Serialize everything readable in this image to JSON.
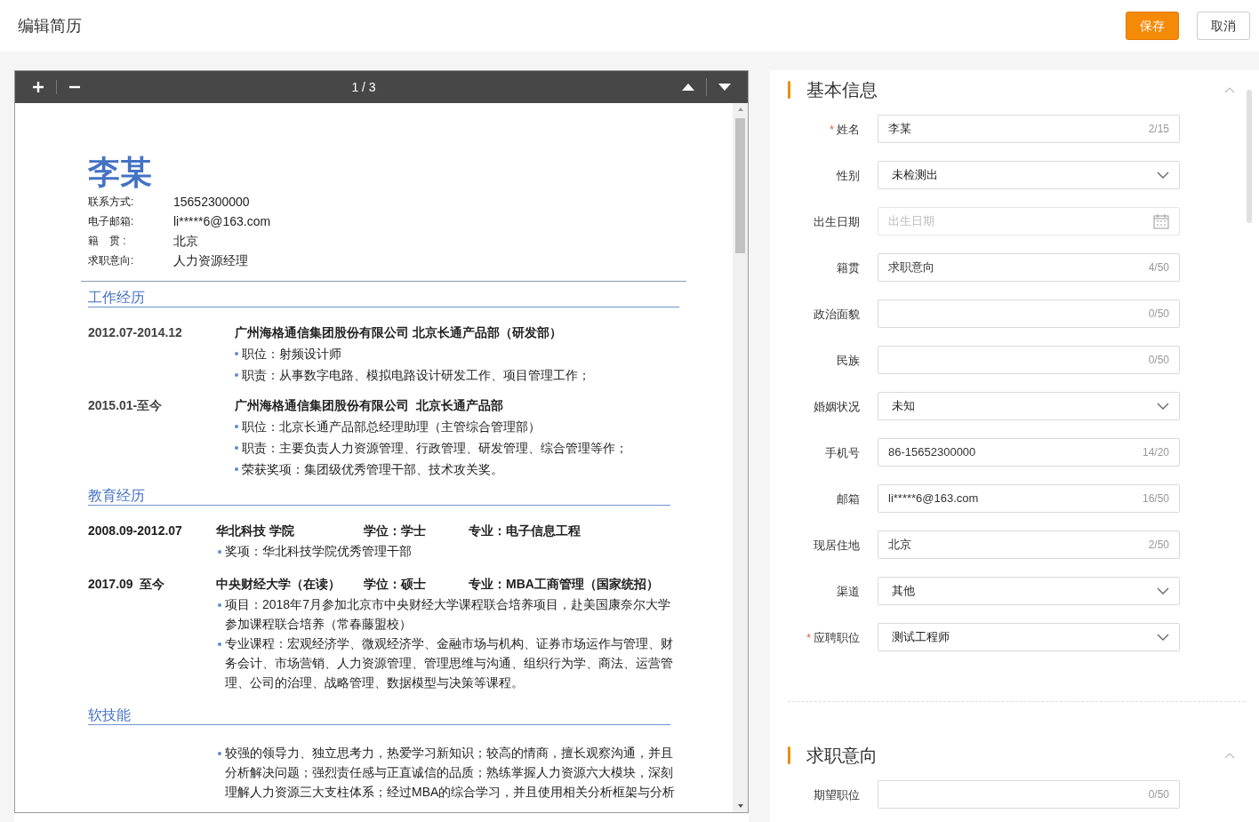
{
  "header": {
    "title": "编辑简历",
    "buttons": [
      {
        "label": "保存",
        "kind": "primary"
      },
      {
        "label": "取消",
        "kind": "default"
      }
    ]
  },
  "viewer": {
    "page_indicator": "1 / 3"
  },
  "resume": {
    "name": "李某",
    "contacts": [
      {
        "label": "联系方式:",
        "value": "15652300000"
      },
      {
        "label": "电子邮箱:",
        "value": "li*****6@163.com"
      },
      {
        "label": "籍　贯 :",
        "value": "北京"
      },
      {
        "label": "求职意向:",
        "value": "人力资源经理"
      }
    ],
    "work": {
      "title": "工作经历",
      "entries": [
        {
          "period": "2012.07-2014.12",
          "title": "广州海格通信集团股份有限公司 北京长通产品部（研发部）",
          "bullets": [
            "职位：射频设计师",
            "职责：从事数字电路、模拟电路设计研发工作、项目管理工作；"
          ]
        },
        {
          "period": "2015.01-至今",
          "title": "广州海格通信集团股份有限公司  北京长通产品部",
          "bullets": [
            "职位：北京长通产品部总经理助理（主管综合管理部）",
            "职责：主要负责人力资源管理、行政管理、研发管理、综合管理等作；",
            "荣获奖项：集团级优秀管理干部、技术攻关奖。"
          ]
        }
      ]
    },
    "education": {
      "title": "教育经历",
      "entries": [
        {
          "period": "2008.09-2012.07",
          "school": "华北科技 学院",
          "degree": "学位：学士",
          "major": "专业：电子信息工程",
          "bullets": [
            "奖项：华北科技学院优秀管理干部"
          ]
        },
        {
          "period": "2017.09  至今",
          "school": "中央财经大学（在读）",
          "degree": "学位：硕士",
          "major": "专业：MBA工商管理（国家统招）",
          "bullets": [
            "项目：2018年7月参加北京市中央财经大学课程联合培养项目，赴美国康奈尔大学参加课程联合培养（常春藤盟校）",
            "专业课程：宏观经济学、微观经济学、金融市场与机构、证券市场运作与管理、财务会计、市场营销、人力资源管理、管理思维与沟通、组织行为学、商法、运营管理、公司的治理、战略管理、数据模型与决策等课程。"
          ]
        }
      ]
    },
    "skills": {
      "title": "软技能",
      "bullets": [
        "较强的领导力、独立思考力，热爱学习新知识；较高的情商，擅长观察沟通，并且分析解决问题；强烈责任感与正直诚信的品质；熟练掌握人力资源六大模块，深刻理解人力资源三大支柱体系；经过MBA的综合学习，并且使用相关分析框架与分析"
      ]
    }
  },
  "form": {
    "sections": [
      {
        "title": "基本信息",
        "expanded": true,
        "fields": [
          {
            "label": "姓名",
            "marker": "*",
            "kind": "text",
            "value": "李某",
            "counter": "2/15"
          },
          {
            "label": "性别",
            "kind": "select",
            "value": "未检测出"
          },
          {
            "label": "出生日期",
            "kind": "date",
            "placeholder": "出生日期"
          },
          {
            "label": "籍贯",
            "kind": "text",
            "value": "求职意向",
            "counter": "4/50"
          },
          {
            "label": "政治面貌",
            "kind": "text",
            "counter": "0/50"
          },
          {
            "label": "民族",
            "kind": "text",
            "counter": "0/50"
          },
          {
            "label": "婚姻状况",
            "kind": "select",
            "value": "未知"
          },
          {
            "label": "手机号",
            "kind": "text",
            "value": "86-15652300000",
            "counter": "14/20"
          },
          {
            "label": "邮箱",
            "kind": "text",
            "value": "li*****6@163.com",
            "counter": "16/50"
          },
          {
            "label": "现居住地",
            "kind": "text",
            "value": "北京",
            "counter": "2/50"
          },
          {
            "label": "渠道",
            "kind": "select",
            "value": "其他"
          },
          {
            "label": "应聘职位",
            "marker": "*",
            "kind": "select",
            "value": "测试工程师"
          }
        ]
      },
      {
        "title": "求职意向",
        "expanded": true,
        "fields": [
          {
            "label": "期望职位",
            "kind": "text",
            "counter": "0/50"
          }
        ]
      }
    ]
  }
}
